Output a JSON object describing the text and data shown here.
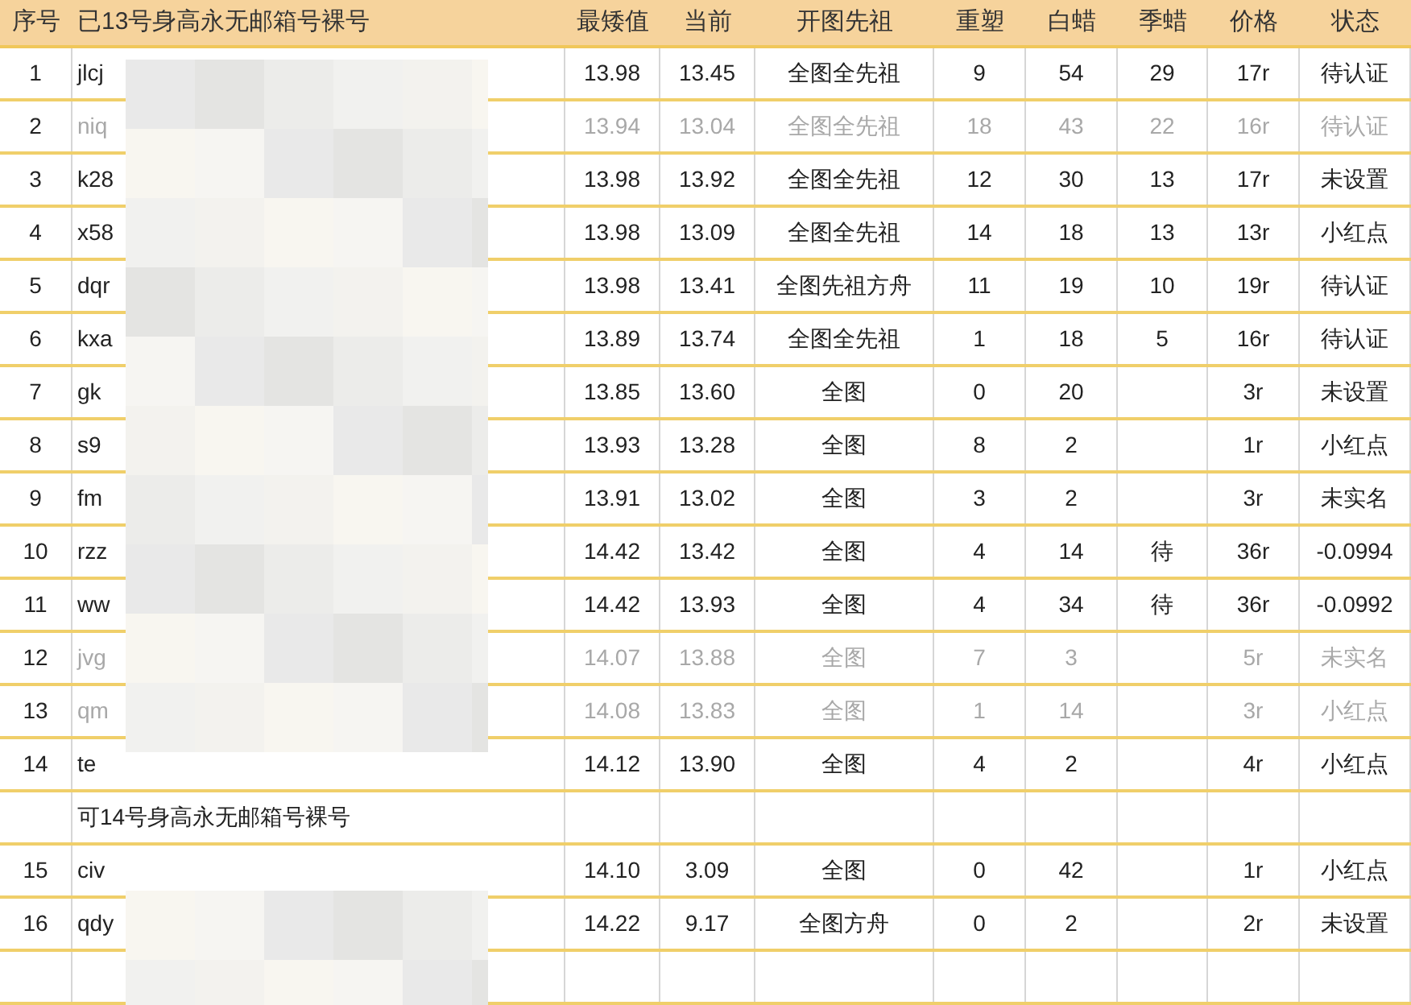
{
  "columns": [
    "序号",
    "已13号身高永无邮箱号裸号",
    "最矮值",
    "当前",
    "开图先祖",
    "重塑",
    "白蜡",
    "季蜡",
    "价格",
    "状态"
  ],
  "rows": [
    {
      "kind": "item",
      "cells": [
        "1",
        "jlcj",
        "13.98",
        "13.45",
        "全图全先祖",
        "9",
        "54",
        "29",
        "17r",
        "待认证"
      ],
      "dimmed": false
    },
    {
      "kind": "item",
      "cells": [
        "2",
        "niq",
        "13.94",
        "13.04",
        "全图全先祖",
        "18",
        "43",
        "22",
        "16r",
        "待认证"
      ],
      "dimmed": true
    },
    {
      "kind": "item",
      "cells": [
        "3",
        "k28",
        "13.98",
        "13.92",
        "全图全先祖",
        "12",
        "30",
        "13",
        "17r",
        "未设置"
      ],
      "dimmed": false
    },
    {
      "kind": "item",
      "cells": [
        "4",
        "x58",
        "13.98",
        "13.09",
        "全图全先祖",
        "14",
        "18",
        "13",
        "13r",
        "小红点"
      ],
      "dimmed": false
    },
    {
      "kind": "item",
      "cells": [
        "5",
        "dqr",
        "13.98",
        "13.41",
        "全图先祖方舟",
        "11",
        "19",
        "10",
        "19r",
        "待认证"
      ],
      "dimmed": false
    },
    {
      "kind": "item",
      "cells": [
        "6",
        "kxa",
        "13.89",
        "13.74",
        "全图全先祖",
        "1",
        "18",
        "5",
        "16r",
        "待认证"
      ],
      "dimmed": false
    },
    {
      "kind": "item",
      "cells": [
        "7",
        "gk",
        "13.85",
        "13.60",
        "全图",
        "0",
        "20",
        "",
        "3r",
        "未设置"
      ],
      "dimmed": false
    },
    {
      "kind": "item",
      "cells": [
        "8",
        "s9",
        "13.93",
        "13.28",
        "全图",
        "8",
        "2",
        "",
        "1r",
        "小红点"
      ],
      "dimmed": false
    },
    {
      "kind": "item",
      "cells": [
        "9",
        "fm",
        "13.91",
        "13.02",
        "全图",
        "3",
        "2",
        "",
        "3r",
        "未实名"
      ],
      "dimmed": false
    },
    {
      "kind": "item",
      "cells": [
        "10",
        "rzz",
        "14.42",
        "13.42",
        "全图",
        "4",
        "14",
        "待",
        "36r",
        "-0.0994"
      ],
      "dimmed": false
    },
    {
      "kind": "item",
      "cells": [
        "11",
        "ww",
        "14.42",
        "13.93",
        "全图",
        "4",
        "34",
        "待",
        "36r",
        "-0.0992"
      ],
      "dimmed": false
    },
    {
      "kind": "item",
      "cells": [
        "12",
        "jvg",
        "14.07",
        "13.88",
        "全图",
        "7",
        "3",
        "",
        "5r",
        "未实名"
      ],
      "dimmed": true
    },
    {
      "kind": "item",
      "cells": [
        "13",
        "qm",
        "14.08",
        "13.83",
        "全图",
        "1",
        "14",
        "",
        "3r",
        "小红点"
      ],
      "dimmed": true
    },
    {
      "kind": "item",
      "cells": [
        "14",
        "te",
        "14.12",
        "13.90",
        "全图",
        "4",
        "2",
        "",
        "4r",
        "小红点"
      ],
      "dimmed": false
    },
    {
      "kind": "section",
      "label": "可14号身高永无邮箱号裸号"
    },
    {
      "kind": "item",
      "cells": [
        "15",
        "civ",
        "14.10",
        "3.09",
        "全图",
        "0",
        "42",
        "",
        "1r",
        "小红点"
      ],
      "dimmed": false
    },
    {
      "kind": "item",
      "cells": [
        "16",
        "qdy",
        "14.22",
        "9.17",
        "全图方舟",
        "0",
        "2",
        "",
        "2r",
        "未设置"
      ],
      "dimmed": false
    }
  ]
}
